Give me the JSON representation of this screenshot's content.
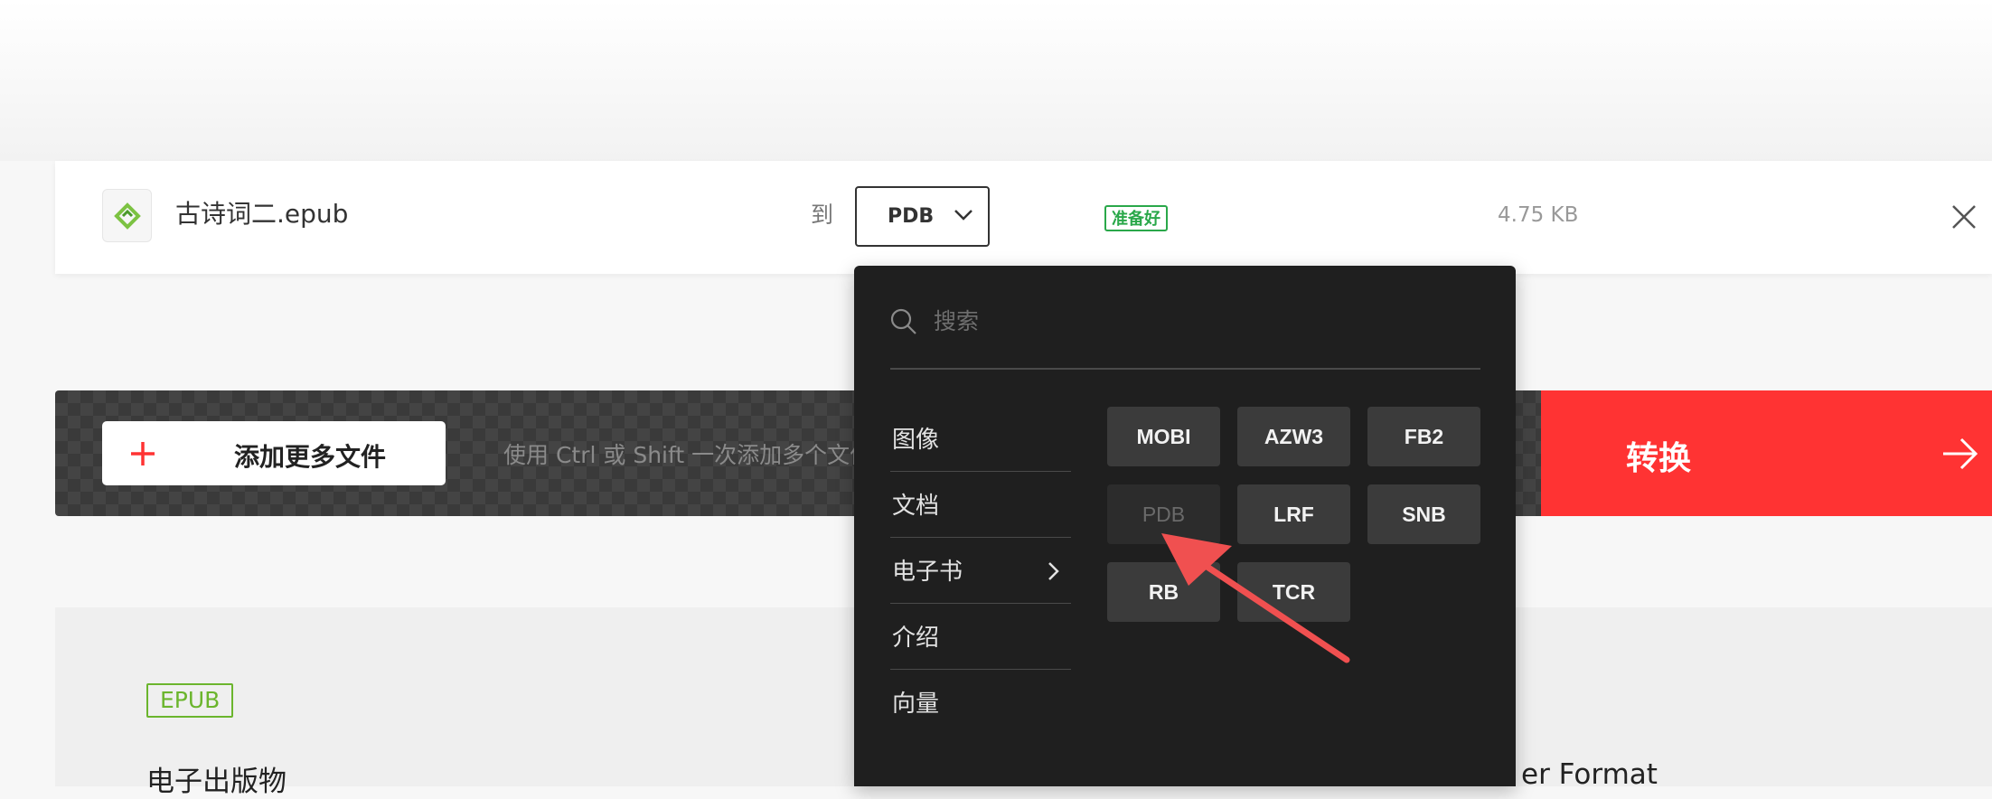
{
  "file": {
    "name": "古诗词二.epub",
    "to_label": "到",
    "selected_format": "PDB",
    "status": "准备好",
    "size": "4.75 KB"
  },
  "actions": {
    "add_more_label": "添加更多文件",
    "hint": "使用 Ctrl 或 Shift 一次添加多个文件",
    "convert_label": "转换"
  },
  "dropdown": {
    "search_placeholder": "搜索",
    "categories": [
      {
        "label": "图像",
        "active": false
      },
      {
        "label": "文档",
        "active": false
      },
      {
        "label": "电子书",
        "active": true
      },
      {
        "label": "介绍",
        "active": false
      },
      {
        "label": "向量",
        "active": false
      }
    ],
    "formats": [
      {
        "label": "MOBI",
        "selected": false
      },
      {
        "label": "AZW3",
        "selected": false
      },
      {
        "label": "FB2",
        "selected": false
      },
      {
        "label": "PDB",
        "selected": true
      },
      {
        "label": "LRF",
        "selected": false
      },
      {
        "label": "SNB",
        "selected": false
      },
      {
        "label": "RB",
        "selected": false
      },
      {
        "label": "TCR",
        "selected": false
      }
    ]
  },
  "info": {
    "extension_tag": "EPUB",
    "extension_desc": "电子出版物",
    "right_desc": "er Format"
  },
  "colors": {
    "accent_red": "#ff3333",
    "ready_green": "#2aa84a",
    "epub_green": "#6bb52d",
    "panel_dark": "#1f1f1f"
  },
  "icons": [
    "epub-file-icon",
    "chevron-down-icon",
    "close-icon",
    "plus-icon",
    "arrow-right-icon",
    "search-icon",
    "chevron-right-icon",
    "annotation-arrow-icon"
  ]
}
